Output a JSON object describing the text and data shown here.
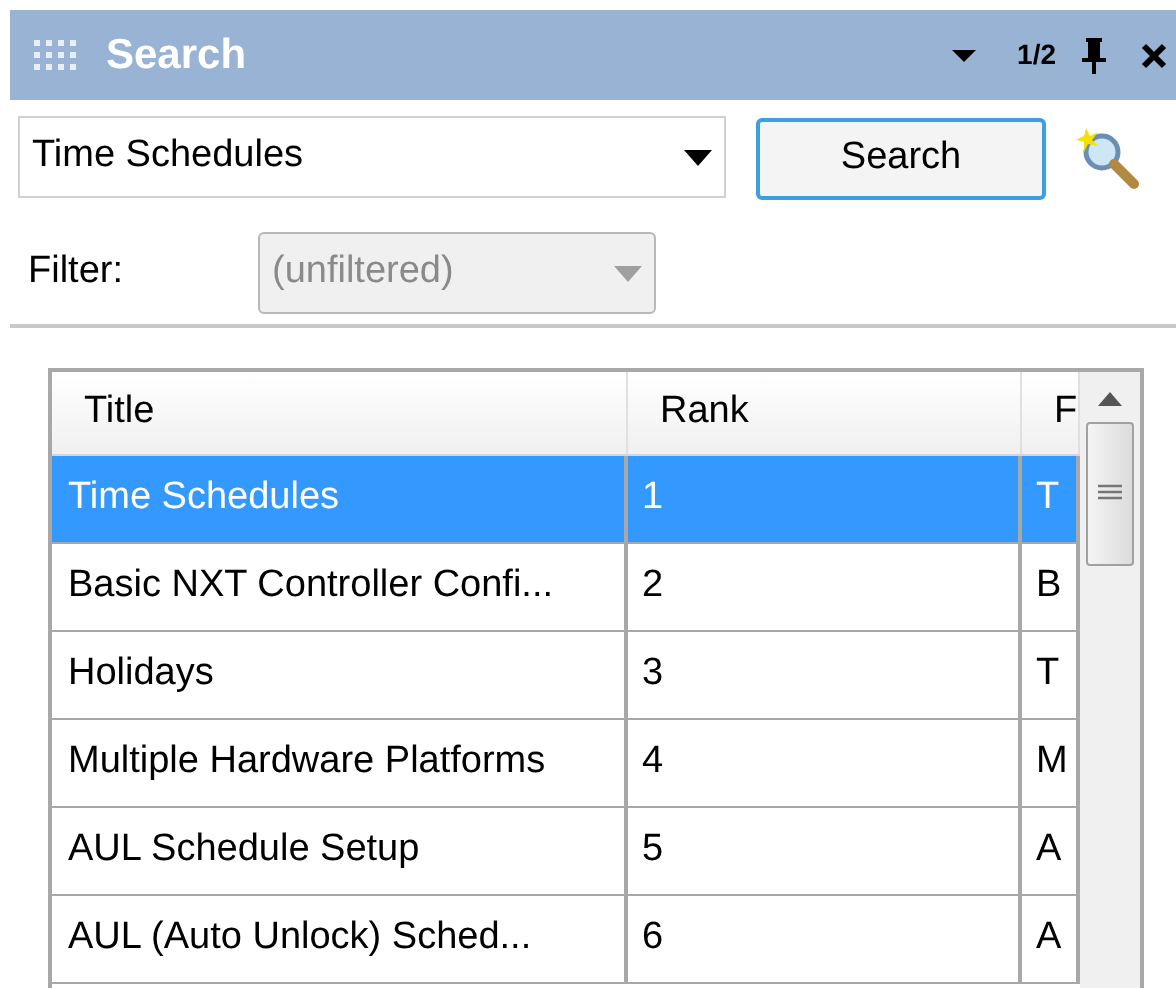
{
  "panel": {
    "title": "Search",
    "page_indicator": "1/2"
  },
  "search": {
    "query": "Time Schedules",
    "button": "Search"
  },
  "filter": {
    "label": "Filter:",
    "value": "(unfiltered)",
    "disabled": true
  },
  "table": {
    "columns": [
      "Title",
      "Rank",
      "F"
    ],
    "rows": [
      {
        "title": "Time Schedules",
        "rank": "1",
        "column_3": "T",
        "selected": true
      },
      {
        "title": "Basic NXT Controller Confi...",
        "rank": "2",
        "column_3": "B",
        "selected": false
      },
      {
        "title": "Holidays",
        "rank": "3",
        "column_3": "T",
        "selected": false
      },
      {
        "title": "Multiple Hardware Platforms",
        "rank": "4",
        "column_3": "M",
        "selected": false
      },
      {
        "title": "AUL Schedule Setup",
        "rank": "5",
        "column_3": "A",
        "selected": false
      },
      {
        "title": "AUL (Auto Unlock) Sched...",
        "rank": "6",
        "column_3": "A",
        "selected": false
      }
    ]
  }
}
